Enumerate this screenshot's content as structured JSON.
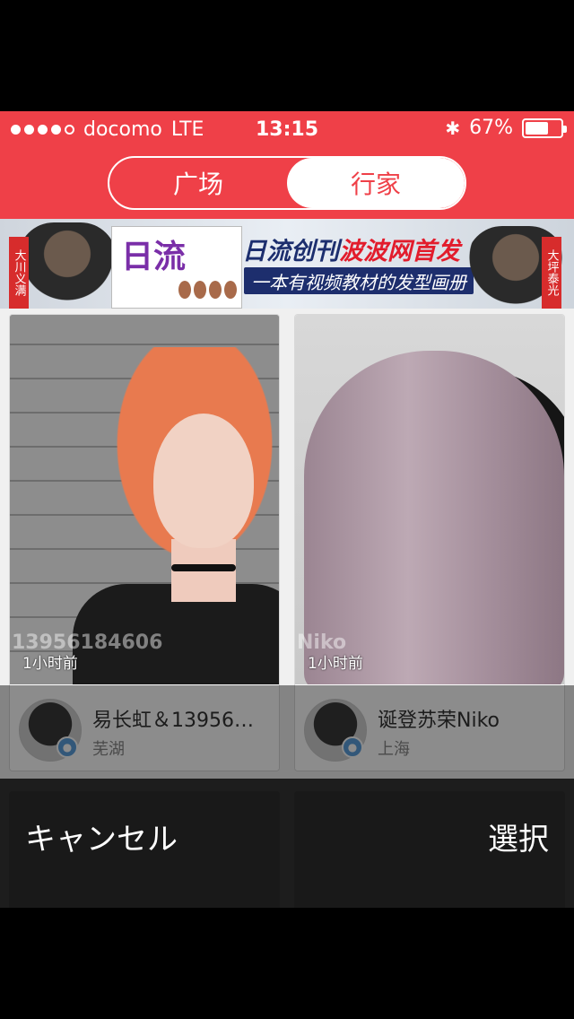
{
  "status_bar": {
    "carrier": "docomo",
    "network": "LTE",
    "time": "13:15",
    "battery": "67%",
    "battery_level": 0.67
  },
  "segmented": {
    "tabs": [
      {
        "label": "广场",
        "active": false
      },
      {
        "label": "行家",
        "active": true
      }
    ]
  },
  "banner": {
    "left_tag": "大川义满",
    "right_tag": "大坪泰光",
    "magazine_title": "日流",
    "headline_part1": "日流创刊",
    "headline_part2": "波波网首发",
    "subline": "一本有视频教材的发型画册"
  },
  "cards": [
    {
      "time": "1小时前",
      "watermark": "13956184606",
      "author": "易长虹＆13956…",
      "city": "芜湖"
    },
    {
      "time": "1小时前",
      "watermark": "Niko",
      "author": "诞登苏荣Niko",
      "city": "上海"
    }
  ],
  "action_sheet": {
    "cancel": "キャンセル",
    "select": "選択"
  },
  "colors": {
    "brand": "#ef4048",
    "badge": "#5b9fdc"
  }
}
